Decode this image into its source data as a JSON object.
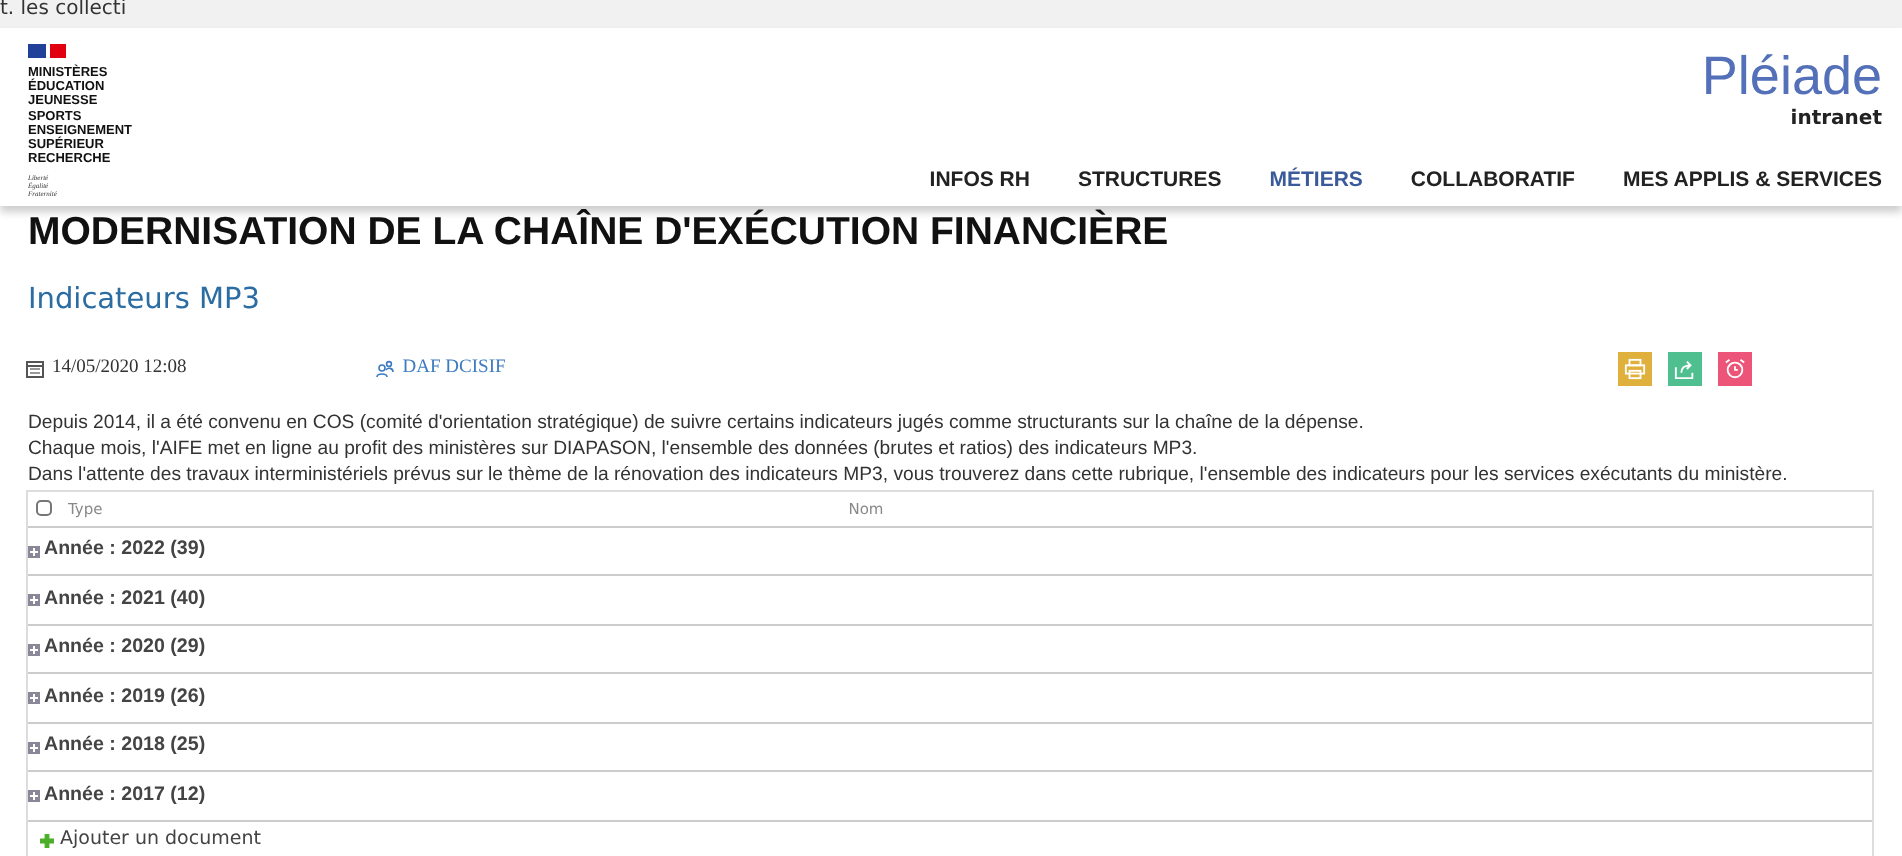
{
  "top_strip": {
    "text": "t. les collecti"
  },
  "logo": {
    "lines": [
      "MINISTÈRES",
      "ÉDUCATION",
      "JEUNESSE",
      "SPORTS",
      "ENSEIGNEMENT",
      "SUPÉRIEUR",
      "RECHERCHE"
    ],
    "motto": [
      "Liberté",
      "Égalité",
      "Fraternité"
    ]
  },
  "brand": {
    "name": "Pléiade",
    "sub": "intranet"
  },
  "nav": [
    {
      "label": "INFOS RH",
      "selected": false
    },
    {
      "label": "STRUCTURES",
      "selected": false
    },
    {
      "label": "MÉTIERS",
      "selected": true
    },
    {
      "label": "COLLABORATIF",
      "selected": false
    },
    {
      "label": "MES APPLIS & SERVICES",
      "selected": false
    }
  ],
  "page_title": "MODERNISATION DE LA CHAÎNE D'EXÉCUTION FINANCIÈRE",
  "subtitle": "Indicateurs MP3",
  "meta": {
    "date": "14/05/2020 12:08",
    "author": "DAF DCISIF"
  },
  "actions": [
    {
      "kind": "print",
      "color": "#e0b03c"
    },
    {
      "kind": "share",
      "color": "#4fbf8f"
    },
    {
      "kind": "alarm",
      "color": "#ec5478"
    }
  ],
  "paragraphs": [
    "Depuis 2014, il a été convenu en COS (comité d'orientation stratégique) de suivre certains indicateurs jugés comme structurants sur la chaîne de la dépense.",
    "Chaque mois, l'AIFE met en ligne au profit des ministères sur DIAPASON, l'ensemble des données (brutes et ratios) des indicateurs MP3.",
    "Dans l'attente des travaux interministériels prévus sur le thème de la rénovation des indicateurs MP3, vous trouverez dans cette rubrique, l'ensemble des indicateurs pour les services exécutants du ministère."
  ],
  "table": {
    "columns": [
      "Type",
      "Nom"
    ],
    "select_all_checked": false,
    "groups": [
      "Année : **2022** (39)",
      "Année : **2021** (40)",
      "Année : **2020** (29)",
      "Année : **2019** (26)",
      "Année : **2018** (25)",
      "Année : **2017** (12)"
    ],
    "add_link": "Ajouter un document"
  }
}
